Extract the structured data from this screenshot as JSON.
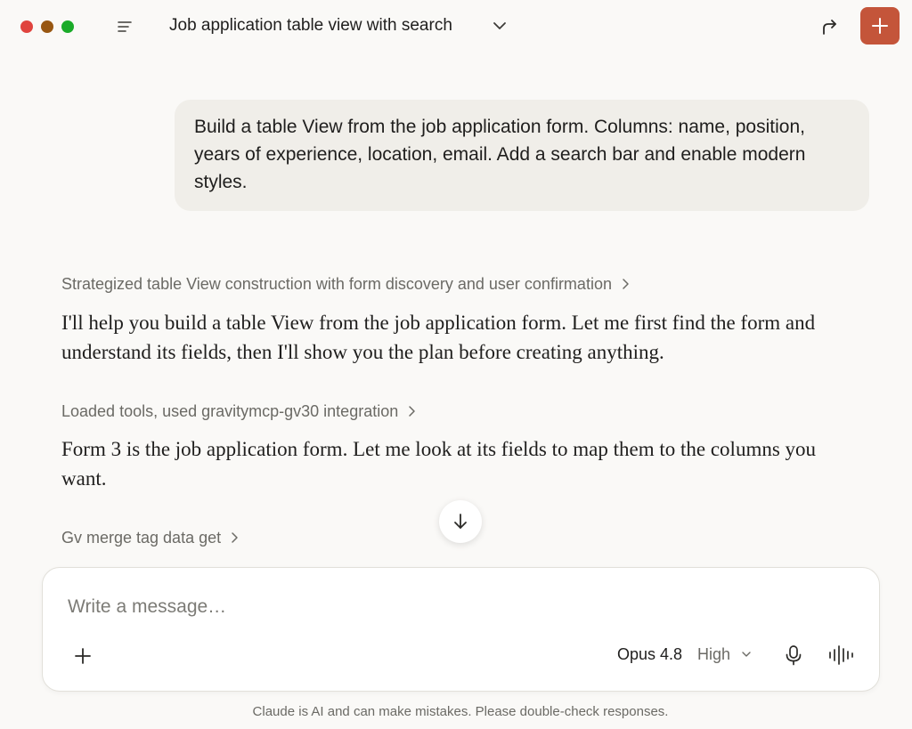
{
  "window": {
    "traffic_lights": {
      "close_color": "#e0443e",
      "minimize_color": "#985712",
      "zoom_color": "#1aab29"
    }
  },
  "header": {
    "sidebar_icon": "sidebar-toggle-icon",
    "title": "Job application table view with search",
    "title_menu_icon": "chevron-down-icon",
    "share_icon": "share-arrow-icon",
    "new_chat_icon": "plus-icon",
    "accent_color": "#c4553a"
  },
  "conversation": {
    "user_message": "Build a table View from the job application form. Columns: name, position, years of experience, location, email. Add a search bar and enable modern styles.",
    "assistant": [
      {
        "kind": "thinking",
        "label": "Strategized table View construction with form discovery and user confirmation"
      },
      {
        "kind": "text",
        "text": "I'll help you build a table View from the job application form. Let me first find the form and understand its fields, then I'll show you the plan before creating anything."
      },
      {
        "kind": "tool",
        "label": "Loaded tools, used gravitymcp-gv30 integration"
      },
      {
        "kind": "text",
        "text": "Form 3 is the job application form. Let me look at its fields to map them to the columns you want."
      },
      {
        "kind": "tool",
        "label": "Gv merge tag data get"
      }
    ],
    "scroll_down_icon": "arrow-down-icon"
  },
  "composer": {
    "placeholder": "Write a message…",
    "value": "",
    "attach_icon": "plus-icon",
    "model_name": "Opus 4.8",
    "effort": "High",
    "effort_icon": "chevron-down-icon",
    "mic_icon": "microphone-icon",
    "voice_icon": "voice-waveform-icon"
  },
  "footer": {
    "disclaimer": "Claude is AI and can make mistakes. Please double-check responses."
  }
}
